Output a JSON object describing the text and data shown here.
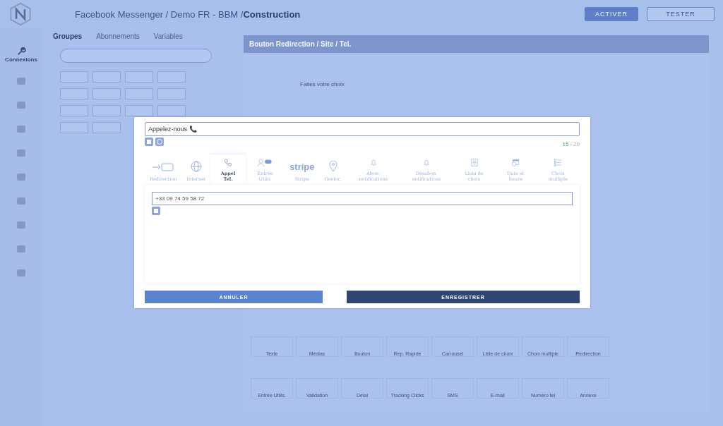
{
  "header": {
    "breadcrumb": "Facebook Messenger / Demo FR - BBM /",
    "current": "Construction",
    "buttons": [
      {
        "label": "ACTIVER",
        "kind": "filled"
      },
      {
        "label": "TESTER",
        "kind": "outline"
      }
    ]
  },
  "nav": {
    "items": [
      {
        "label": "Connexions"
      }
    ]
  },
  "left_panel": {
    "tabs": [
      {
        "label": "Groupes",
        "selected": true
      },
      {
        "label": "Abonnements",
        "selected": false
      },
      {
        "label": "Variables",
        "selected": false
      }
    ]
  },
  "editor": {
    "title": "Bouton Redirection / Site / Tel.",
    "prompt": "Faites votre choix",
    "blocks": [
      {
        "label": "Texte"
      },
      {
        "label": "Médias"
      },
      {
        "label": "Bouton"
      },
      {
        "label": "Rep. Rapide"
      },
      {
        "label": "Carrousel"
      },
      {
        "label": "Liste de choix"
      },
      {
        "label": "Choix multiple"
      },
      {
        "label": "Redirection"
      },
      {
        "label": "Entrée Utilis."
      },
      {
        "label": "Validation"
      },
      {
        "label": "Délai"
      },
      {
        "label": "Tracking Clicks"
      },
      {
        "label": "SMS"
      },
      {
        "label": "E-mail"
      },
      {
        "label": "Numéro tel"
      },
      {
        "label": "Annexe"
      }
    ]
  },
  "dialog": {
    "title_field": {
      "value": "Appelez-nous 📞"
    },
    "count": "15",
    "limit": "/ 20",
    "tabs": [
      {
        "label": "Redirection",
        "kind": "redirect",
        "selected": false
      },
      {
        "label": "Internet",
        "kind": "globe",
        "selected": false
      },
      {
        "label": "Appel Tel.",
        "kind": "phone",
        "selected": true
      },
      {
        "label": "Entrée Utils.",
        "kind": "user",
        "selected": false
      },
      {
        "label": "Stripe",
        "kind": "stripe",
        "logo": "stripe",
        "selected": false
      },
      {
        "label": "Geoloc.",
        "kind": "pin",
        "selected": false
      },
      {
        "label": "Abon. notifications",
        "kind": "bell",
        "selected": false
      },
      {
        "label": "Désabon. notifications",
        "kind": "bell",
        "selected": false
      },
      {
        "label": "Liste de choix",
        "kind": "list",
        "selected": false
      },
      {
        "label": "Date et heure",
        "kind": "calendar",
        "selected": false
      },
      {
        "label": "Choix multiple",
        "kind": "checklist",
        "selected": false
      }
    ],
    "phone_field": {
      "value": "+33 09 74 59 58 72"
    },
    "buttons": [
      {
        "label": "ANNULER",
        "kind": "cancel"
      },
      {
        "label": "ENREGISTRER",
        "kind": "save"
      }
    ]
  }
}
